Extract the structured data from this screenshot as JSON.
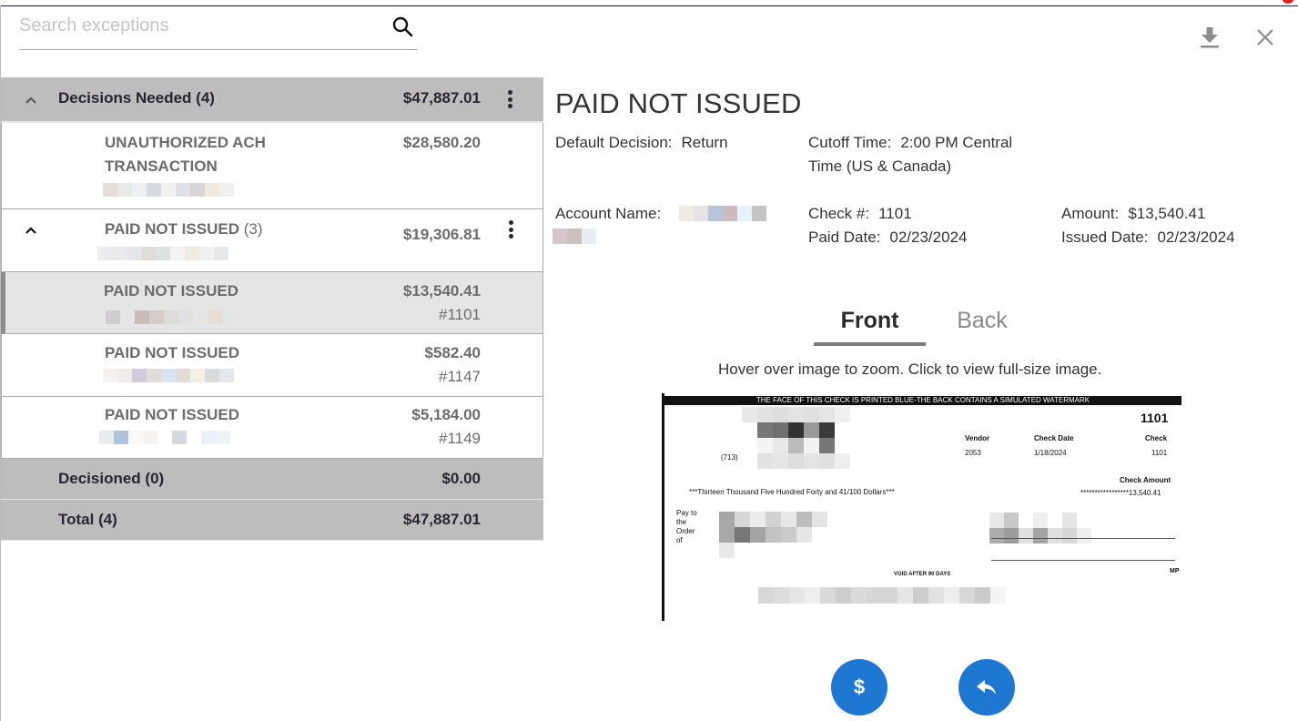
{
  "search": {
    "placeholder": "Search exceptions",
    "value": ""
  },
  "icons": {
    "search": "search-icon",
    "download": "download-icon",
    "close": "close-icon",
    "collapse": "chevron-up-icon",
    "more": "more-vertical-icon",
    "pay": "dollar-icon",
    "return": "reply-icon"
  },
  "exceptions": {
    "decisions_needed": {
      "label": "Decisions Needed (4)",
      "amount": "$47,887.01"
    },
    "items": [
      {
        "type": "UNAUTHORIZED ACH TRANSACTION",
        "type_line1": "UNAUTHORIZED ACH",
        "type_line2": "TRANSACTION",
        "amount": "$28,580.20",
        "account": "[redacted]"
      }
    ],
    "pni_group": {
      "label": "PAID NOT ISSUED",
      "count": "(3)",
      "amount": "$19,306.81",
      "account": "[redacted]"
    },
    "pni_items": [
      {
        "type": "PAID NOT ISSUED",
        "amount": "$13,540.41",
        "check": "#1101",
        "account": "[redacted]",
        "selected": true
      },
      {
        "type": "PAID NOT ISSUED",
        "amount": "$582.40",
        "check": "#1147",
        "account": "[redacted]",
        "selected": false
      },
      {
        "type": "PAID NOT ISSUED",
        "amount": "$5,184.00",
        "check": "#1149",
        "account": "[redacted]",
        "selected": false
      }
    ],
    "decisioned": {
      "label": "Decisioned (0)",
      "amount": "$0.00"
    },
    "total": {
      "label": "Total (4)",
      "amount": "$47,887.01"
    }
  },
  "detail": {
    "title": "PAID NOT ISSUED",
    "default_decision": {
      "label": "Default Decision:",
      "value": "Return"
    },
    "cutoff_time": {
      "label": "Cutoff Time:",
      "value_line1": "2:00 PM Central",
      "value_line2": "Time (US & Canada)"
    },
    "account_name": {
      "label": "Account Name:",
      "value": "[redacted]"
    },
    "check_number": {
      "label": "Check #:",
      "value": "1101"
    },
    "paid_date": {
      "label": "Paid Date:",
      "value": "02/23/2024"
    },
    "amount": {
      "label": "Amount:",
      "value": "$13,540.41"
    },
    "issued_date": {
      "label": "Issued Date:",
      "value": "02/23/2024"
    },
    "tabs": [
      {
        "label": "Front",
        "active": true
      },
      {
        "label": "Back",
        "active": false
      }
    ],
    "image_hint": "Hover over image to zoom. Click to view full-size image.",
    "check_image": {
      "banner": "THE FACE OF THIS CHECK IS PRINTED BLUE-THE BACK CONTAINS A SIMULATED WATERMARK",
      "check_no": "1101",
      "vendor_label": "Vendor",
      "vendor_value": "2053",
      "check_date_label": "Check Date",
      "check_date_value": "1/18/2024",
      "check_label": "Check",
      "check_value": "1101",
      "phone_prefix": "(713)",
      "check_amount_label": "Check Amount",
      "check_amount_value": "*****************13,540.41",
      "amount_words": "***Thirteen Thousand Five Hundred Forty and 41/100 Dollars***",
      "pay_to_1": "Pay to",
      "pay_to_2": "the",
      "pay_to_3": "Order",
      "pay_to_4": "of",
      "void_text": "VOID AFTER 90 DAYS",
      "mp_text": "MP"
    },
    "actions": {
      "pay_label": "$",
      "pay_color": "#1e78d2",
      "return_color": "#1e78d2"
    }
  }
}
